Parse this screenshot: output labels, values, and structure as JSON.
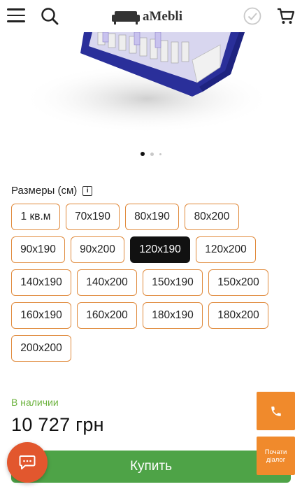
{
  "header": {
    "logo_text": "aMebli",
    "icons": [
      "menu-icon",
      "search-icon",
      "compare-check-icon",
      "cart-icon"
    ]
  },
  "gallery": {
    "slides_count": 3,
    "active_index": 0
  },
  "sizes": {
    "title": "Размеры (см)",
    "options": [
      {
        "label": "1 кв.м",
        "selected": false
      },
      {
        "label": "70х190",
        "selected": false
      },
      {
        "label": "80х190",
        "selected": false
      },
      {
        "label": "80х200",
        "selected": false
      },
      {
        "label": "90х190",
        "selected": false
      },
      {
        "label": "90х200",
        "selected": false
      },
      {
        "label": "120х190",
        "selected": true
      },
      {
        "label": "120х200",
        "selected": false
      },
      {
        "label": "140х190",
        "selected": false
      },
      {
        "label": "140х200",
        "selected": false
      },
      {
        "label": "150х190",
        "selected": false
      },
      {
        "label": "150х200",
        "selected": false
      },
      {
        "label": "160х190",
        "selected": false
      },
      {
        "label": "160х200",
        "selected": false
      },
      {
        "label": "180х190",
        "selected": false
      },
      {
        "label": "180х200",
        "selected": false
      },
      {
        "label": "200х200",
        "selected": false
      }
    ]
  },
  "product": {
    "availability": "В наличии",
    "price": "10 727 грн",
    "buy_label": "Купить"
  },
  "contact": {
    "dialog_line1": "Почати",
    "dialog_line2": "діалог"
  },
  "colors": {
    "accent_orange": "#f08a2c",
    "buy_green": "#4ea347",
    "availability_green": "#6db33f",
    "size_border": "#e08a3c",
    "chat_red": "#e2572e"
  }
}
